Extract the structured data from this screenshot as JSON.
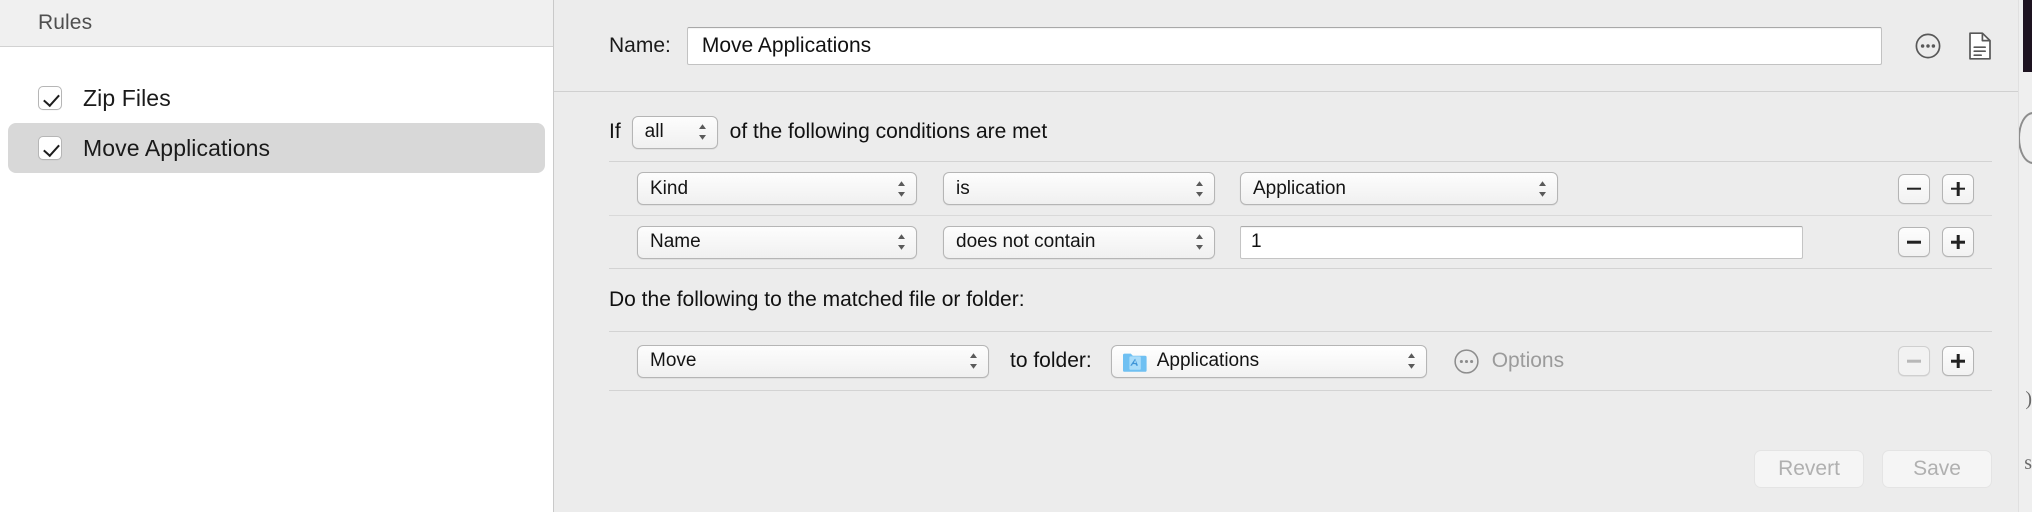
{
  "sidebar": {
    "header_title": "Rules",
    "rules": [
      {
        "label": "Zip Files",
        "checked": true,
        "selected": false
      },
      {
        "label": "Move Applications",
        "checked": true,
        "selected": true
      }
    ]
  },
  "detail": {
    "name_label": "Name:",
    "name_value": "Move Applications",
    "name_placeholder": "Rule name",
    "header_icons": [
      {
        "name": "more-options-icon"
      },
      {
        "name": "document-icon"
      }
    ],
    "conditions": {
      "if_text": "If",
      "match_mode": "all",
      "of_text": "of the following conditions are met",
      "rows": [
        {
          "attribute": "Kind",
          "operator": "is",
          "value_kind": "popup",
          "value": "Application",
          "remove_label": "remove condition",
          "add_label": "add condition"
        },
        {
          "attribute": "Name",
          "operator": "does not contain",
          "value_kind": "text",
          "value": "1",
          "value_placeholder": "",
          "remove_label": "remove condition",
          "add_label": "add condition"
        }
      ]
    },
    "actions": {
      "heading": "Do the following to the matched file or folder:",
      "rows": [
        {
          "action": "Move",
          "to_folder_label": "to folder:",
          "folder": "Applications",
          "folder_icon": "applications-folder-icon",
          "options_label": "Options",
          "options_icon": "ellipsis-circle-icon"
        }
      ]
    },
    "footer": {
      "revert_label": "Revert",
      "save_label": "Save"
    }
  },
  "colors": {
    "window_bg": "#ececec",
    "sidebar_bg": "#ffffff",
    "selection": "#d8d8d8",
    "folder_blue": "#5ab2ee",
    "disabled_text": "#b0b0b0"
  }
}
